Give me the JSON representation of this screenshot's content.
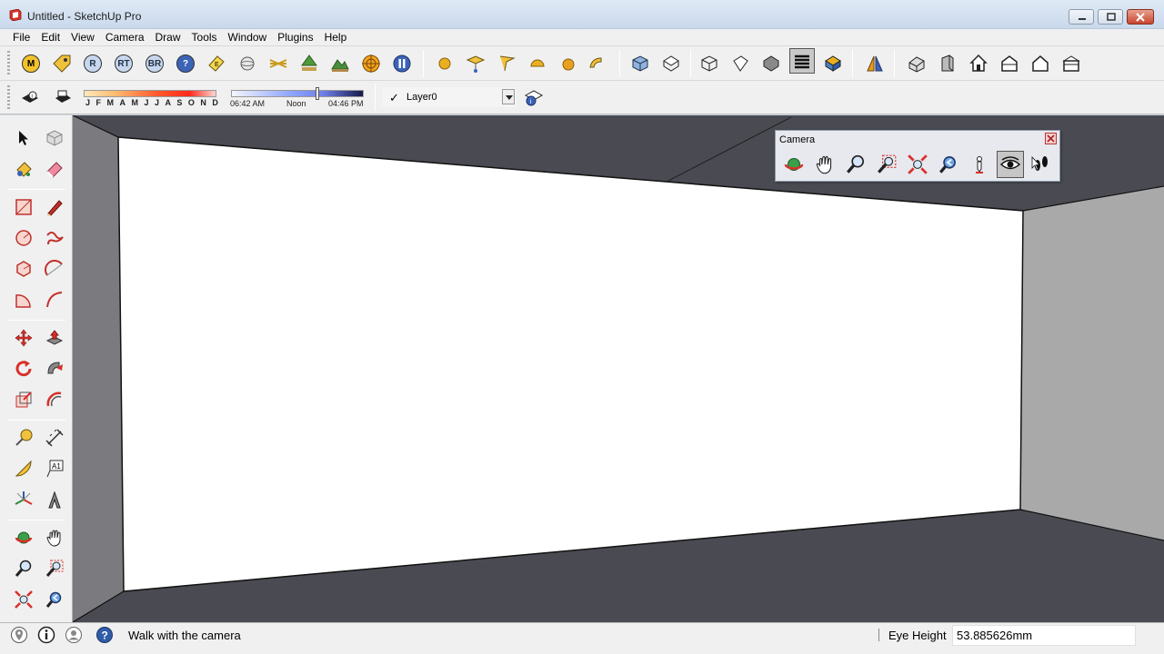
{
  "window": {
    "title": "Untitled - SketchUp Pro"
  },
  "menu": {
    "items": [
      "File",
      "Edit",
      "View",
      "Camera",
      "Draw",
      "Tools",
      "Window",
      "Plugins",
      "Help"
    ]
  },
  "toolbar": {
    "plugin_letters": [
      "M",
      "R",
      "RT",
      "BR",
      "?"
    ]
  },
  "shadows": {
    "months": [
      "J",
      "F",
      "M",
      "A",
      "M",
      "J",
      "J",
      "A",
      "S",
      "O",
      "N",
      "D"
    ],
    "time_start": "06:42 AM",
    "time_mid": "Noon",
    "time_end": "04:46 PM",
    "time_position": 0.65
  },
  "layers": {
    "current": "Layer0",
    "check": "✓"
  },
  "camera_panel": {
    "title": "Camera",
    "close_label": "×",
    "active_tool": "look-around"
  },
  "status": {
    "message": "Walk with the camera",
    "vcb_label": "Eye Height",
    "vcb_value": "53.885626mm"
  },
  "colors": {
    "accent": "#2f5da8",
    "wall": "#ffffff",
    "floor": "#4a4b52",
    "side_wall": "#a9a9a9"
  }
}
